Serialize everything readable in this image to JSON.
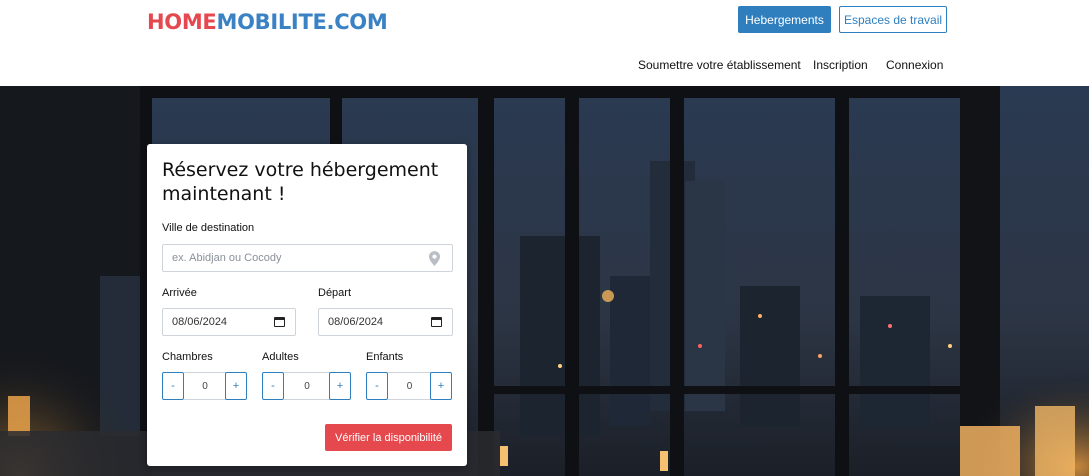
{
  "header": {
    "logo_part1": "HOME",
    "logo_part2": "MOBILITE.COM",
    "btn_hebergements": "Hebergements",
    "btn_espaces": "Espaces de travail",
    "nav": [
      "Soumettre votre établissement",
      "Inscription",
      "Connexion"
    ]
  },
  "booking": {
    "title_line1": "Réservez votre hébergement",
    "title_line2": "maintenant !",
    "destination_label": "Ville de destination",
    "destination_placeholder": "ex. Abidjan ou Cocody",
    "arrival_label": "Arrivée",
    "arrival_value": "08/06/2024",
    "departure_label": "Départ",
    "departure_value": "08/06/2024",
    "rooms_label": "Chambres",
    "adults_label": "Adultes",
    "children_label": "Enfants",
    "rooms_value": "0",
    "adults_value": "0",
    "children_value": "0",
    "minus": "-",
    "plus": "+",
    "verify_button": "Vérifier la disponibilité"
  },
  "icons": {
    "location": "map-pin-icon",
    "calendar": "calendar-icon"
  },
  "colors": {
    "brand_red": "#e6484f",
    "brand_blue": "#3b82c4",
    "primary_button": "#2f7fbf",
    "verify_button": "#e5484d"
  }
}
